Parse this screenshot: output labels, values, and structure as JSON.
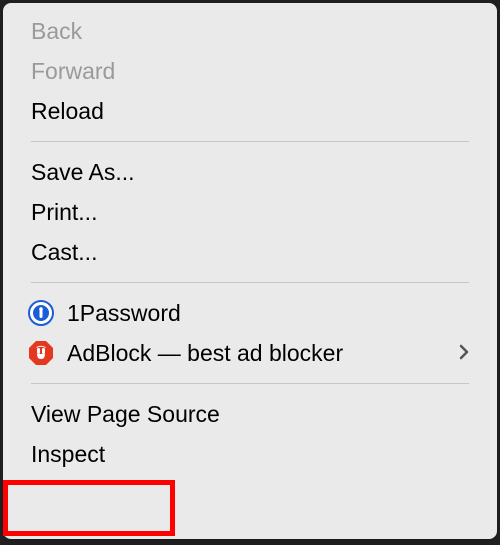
{
  "menu": {
    "back": "Back",
    "forward": "Forward",
    "reload": "Reload",
    "saveAs": "Save As...",
    "print": "Print...",
    "cast": "Cast...",
    "onepassword": "1Password",
    "adblock": "AdBlock — best ad blocker",
    "viewSource": "View Page Source",
    "inspect": "Inspect"
  }
}
